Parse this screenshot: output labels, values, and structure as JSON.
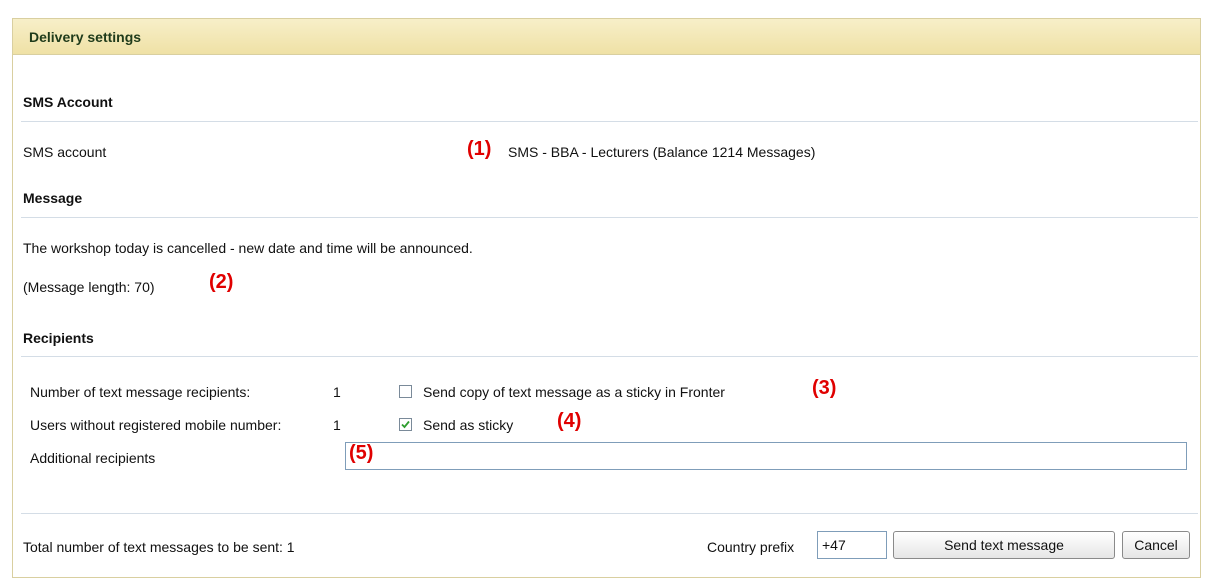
{
  "panel": {
    "title": "Delivery settings"
  },
  "sms_account": {
    "section_title": "SMS Account",
    "label": "SMS account",
    "value": "SMS - BBA - Lecturers (Balance 1214 Messages)",
    "annotation": "(1)"
  },
  "message": {
    "section_title": "Message",
    "text": "The workshop today is cancelled - new date and time will be announced.",
    "length_text": "(Message length: 70)",
    "annotation": "(2)"
  },
  "recipients": {
    "section_title": "Recipients",
    "count_label": "Number of text message recipients:",
    "count_value": "1",
    "copy_sticky_label": "Send copy of text message as a sticky in Fronter",
    "copy_sticky_checked": false,
    "copy_sticky_annotation": "(3)",
    "no_mobile_label": "Users without registered mobile number:",
    "no_mobile_value": "1",
    "send_sticky_label": "Send as sticky",
    "send_sticky_checked": true,
    "send_sticky_annotation": "(4)",
    "additional_label": "Additional recipients",
    "additional_value": "",
    "additional_annotation": "(5)"
  },
  "footer": {
    "total_text": "Total number of text messages to be sent: 1",
    "country_prefix_label": "Country prefix",
    "country_prefix_value": "+47",
    "send_button": "Send text message",
    "cancel_button": "Cancel"
  },
  "colors": {
    "annotation": "#e00000",
    "header_bg": "#efe1a6",
    "divider": "#d4dde6"
  }
}
